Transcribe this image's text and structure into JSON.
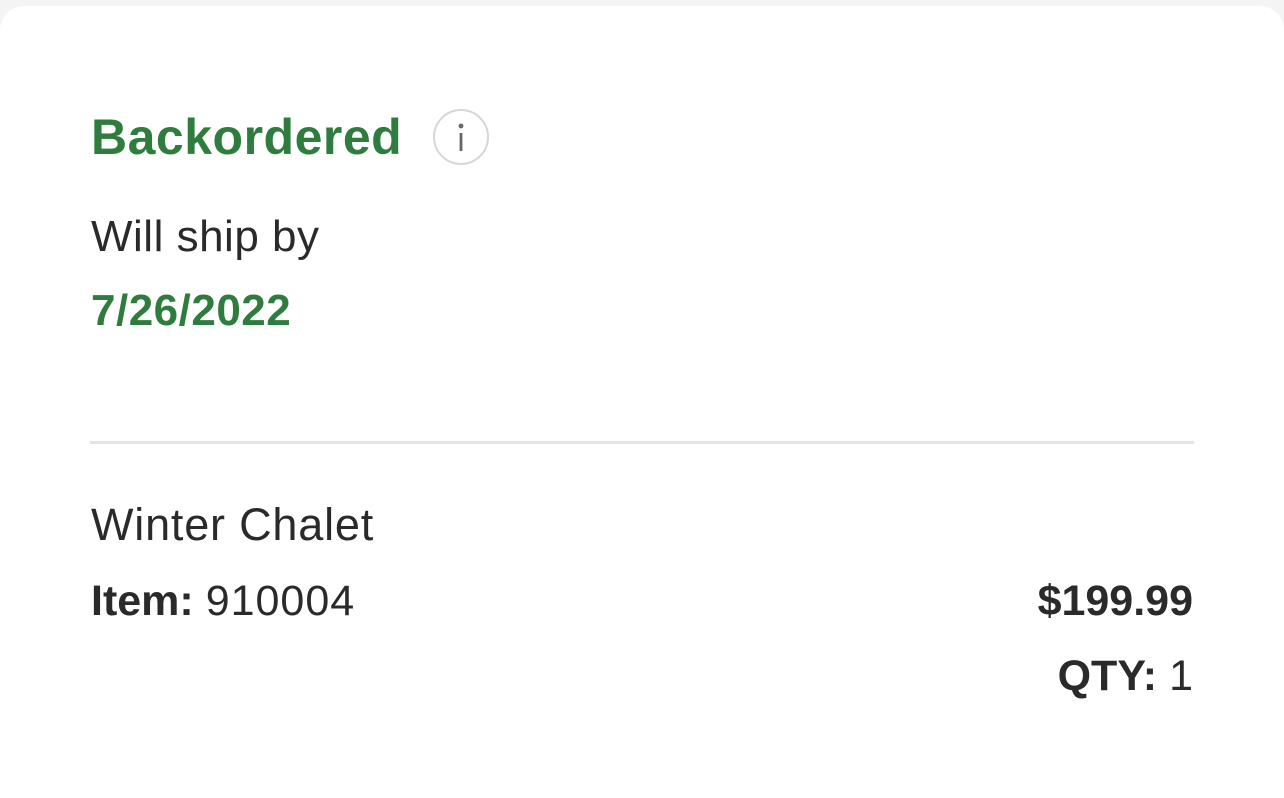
{
  "status": {
    "title": "Backordered",
    "info_icon": "info-icon",
    "info_glyph": "i",
    "color": "#2e7d3e"
  },
  "shipping": {
    "label": "Will ship by",
    "date": "7/26/2022"
  },
  "item": {
    "name": "Winter Chalet",
    "number_label": "Item:",
    "number": "910004",
    "price": "$199.99",
    "qty_label": "QTY:",
    "qty": "1"
  }
}
